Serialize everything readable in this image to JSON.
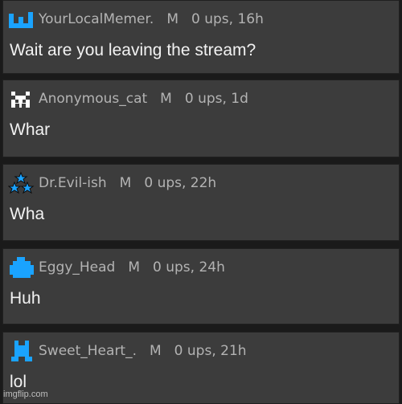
{
  "comments": [
    {
      "username": "YourLocalMemer.",
      "mod": "M",
      "meta": "0 ups, 16h",
      "text": "Wait are you leaving the stream?",
      "avatar": "blue-bars-icon"
    },
    {
      "username": "Anonymous_cat",
      "mod": "M",
      "meta": "0 ups, 1d",
      "text": "Whar",
      "avatar": "pixel-cat-icon"
    },
    {
      "username": "Dr.Evil-ish",
      "mod": "M",
      "meta": "0 ups, 22h",
      "text": "Wha",
      "avatar": "star-triangle-icon"
    },
    {
      "username": "Eggy_Head",
      "mod": "M",
      "meta": "0 ups, 24h",
      "text": "Huh",
      "avatar": "blue-blob-icon"
    },
    {
      "username": "Sweet_Heart_.",
      "mod": "M",
      "meta": "0 ups, 21h",
      "text": "lol",
      "avatar": "blue-figure-icon"
    }
  ],
  "watermark": "imgflip.com",
  "colors": {
    "panel": "#3c3c3c",
    "meta_text": "#b3b3b3",
    "body_text": "#f2f2f2",
    "avatar_blue": "#1aa3ff"
  }
}
